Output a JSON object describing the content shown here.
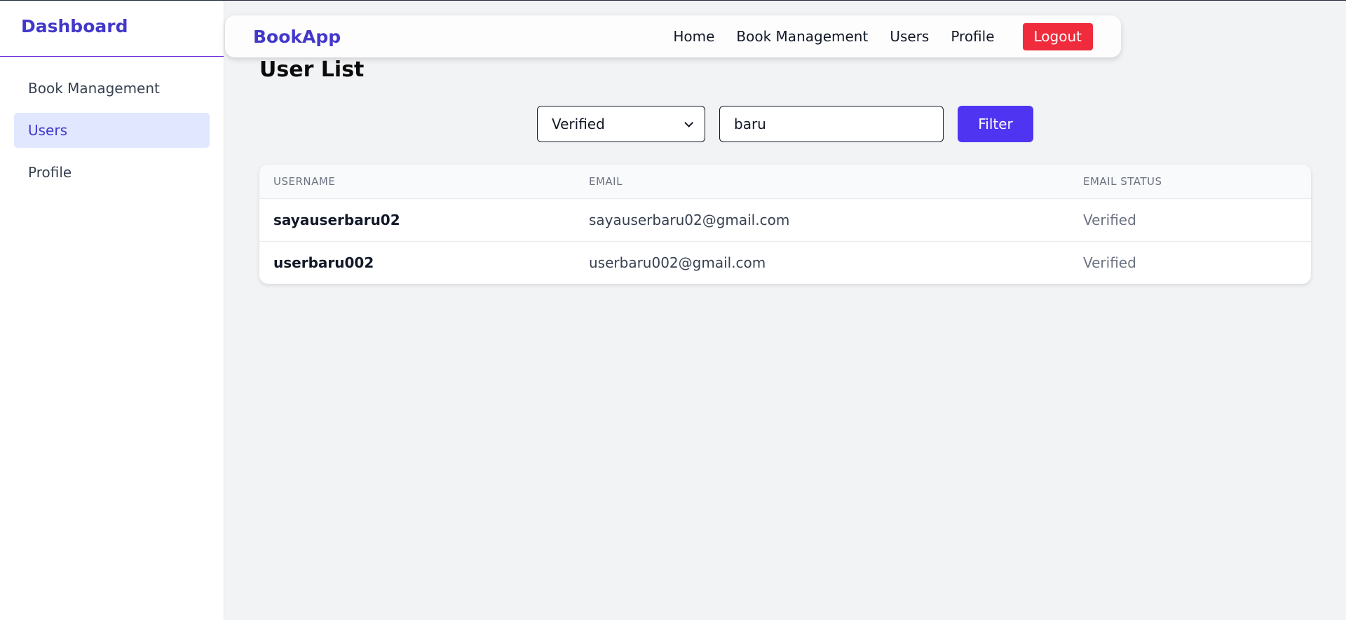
{
  "sidebar": {
    "brand": "Dashboard",
    "items": [
      {
        "label": "Book Management"
      },
      {
        "label": "Users"
      },
      {
        "label": "Profile"
      }
    ]
  },
  "topnav": {
    "brand": "BookApp",
    "links": [
      "Home",
      "Book Management",
      "Users",
      "Profile"
    ],
    "logout_label": "Logout"
  },
  "main": {
    "title": "User List",
    "filters": {
      "status_selected": "Verified",
      "search_value": "baru",
      "filter_label": "Filter"
    },
    "table": {
      "headers": [
        "USERNAME",
        "EMAIL",
        "EMAIL STATUS"
      ],
      "rows": [
        {
          "username": "sayauserbaru02",
          "email": "sayauserbaru02@gmail.com",
          "status": "Verified"
        },
        {
          "username": "userbaru002",
          "email": "userbaru002@gmail.com",
          "status": "Verified"
        }
      ]
    }
  },
  "colors": {
    "brand": "#4338ca",
    "primary_button": "#4f35f1",
    "logout_button": "#ef2b3c",
    "active_item_bg": "#e0e7ff",
    "page_bg": "#f2f3f5"
  }
}
